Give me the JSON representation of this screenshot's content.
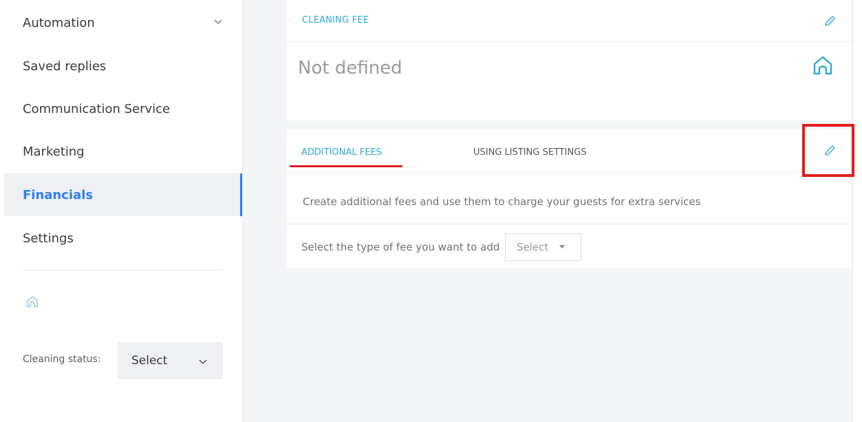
{
  "sidebar": {
    "items": [
      {
        "label": "Automation"
      },
      {
        "label": "Saved replies"
      },
      {
        "label": "Communication Service"
      },
      {
        "label": "Marketing"
      },
      {
        "label": "Financials"
      },
      {
        "label": "Settings"
      }
    ],
    "active_item": "Financials",
    "cleaning_status": {
      "label": "Cleaning status:",
      "value": "Select"
    }
  },
  "cleaning_fee": {
    "title": "CLEANING FEE",
    "value": "Not defined"
  },
  "additional_fees": {
    "tabs": [
      {
        "label": "ADDITIONAL FEES",
        "active": true
      },
      {
        "label": "USING LISTING SETTINGS",
        "active": false
      }
    ],
    "description": "Create additional fees and use them to charge your guests for extra services",
    "select_label": "Select the type of fee you want to add",
    "select_value": "Select"
  },
  "colors": {
    "accent": "#2ea7d8",
    "active_nav": "#2f80ed",
    "highlight": "#e51b1b",
    "underline": "#e31b23"
  }
}
